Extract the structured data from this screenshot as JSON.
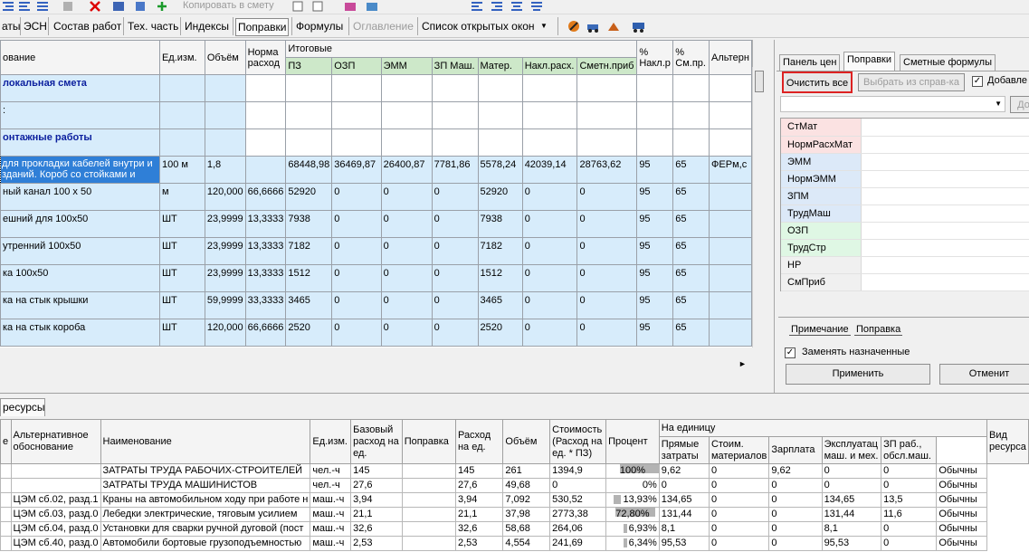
{
  "toolbar_top": {
    "copy_label": "Копировать в смету"
  },
  "tabs": [
    {
      "label": "аты",
      "state": "normal"
    },
    {
      "label": "ЭСН",
      "state": "normal"
    },
    {
      "label": "Состав работ",
      "state": "normal"
    },
    {
      "label": "Тех. часть",
      "state": "normal"
    },
    {
      "label": "Индексы",
      "state": "normal"
    },
    {
      "label": "Поправки",
      "state": "selected"
    },
    {
      "label": "Формулы",
      "state": "normal"
    },
    {
      "label": "Оглавление",
      "state": "disabled"
    },
    {
      "label": "Список открытых окон",
      "state": "normal"
    }
  ],
  "main_grid": {
    "headers": {
      "name": "ование",
      "unit": "Ед.изм.",
      "volume": "Объём",
      "norm": "Норма расход",
      "totals": "Итоговые",
      "pz": "ПЗ",
      "ozp": "ОЗП",
      "emm": "ЭММ",
      "zpm": "ЗП Маш.",
      "mater": "Матер.",
      "nakl": "Накл.расх.",
      "smetn": "Сметн.приб",
      "pnakl": "% Накл.р",
      "psm": "% См.пр.",
      "alt": "Альтерн"
    },
    "rows": [
      {
        "type": "header",
        "name": "локальная смета"
      },
      {
        "type": "blank",
        "name": ":"
      },
      {
        "type": "header",
        "name": "онтажные работы"
      },
      {
        "type": "selected",
        "name": "для прокладки кабелей внутри и зданий. Короб со стойками и",
        "unit": "100 м",
        "volume": "1,8",
        "norm": "",
        "pz": "68448,98",
        "ozp": "36469,87",
        "emm": "26400,87",
        "zpm": "7781,86",
        "mater": "5578,24",
        "nakl": "42039,14",
        "smetn": "28763,62",
        "pnakl": "95",
        "psm": "65",
        "alt": "ФЕРм,с"
      },
      {
        "type": "item",
        "name": "ный канал 100 х 50",
        "unit": "м",
        "volume": "120,000",
        "norm": "66,6666",
        "pz": "52920",
        "ozp": "0",
        "emm": "0",
        "zpm": "0",
        "mater": "52920",
        "nakl": "0",
        "smetn": "0",
        "pnakl": "95",
        "psm": "65",
        "alt": ""
      },
      {
        "type": "item",
        "name": "ешний для 100х50",
        "unit": "ШТ",
        "volume": "23,9999",
        "norm": "13,3333",
        "pz": "7938",
        "ozp": "0",
        "emm": "0",
        "zpm": "0",
        "mater": "7938",
        "nakl": "0",
        "smetn": "0",
        "pnakl": "95",
        "psm": "65",
        "alt": ""
      },
      {
        "type": "item",
        "name": "утренний 100х50",
        "unit": "ШТ",
        "volume": "23,9999",
        "norm": "13,3333",
        "pz": "7182",
        "ozp": "0",
        "emm": "0",
        "zpm": "0",
        "mater": "7182",
        "nakl": "0",
        "smetn": "0",
        "pnakl": "95",
        "psm": "65",
        "alt": ""
      },
      {
        "type": "item",
        "name": "ка 100х50",
        "unit": "ШТ",
        "volume": "23,9999",
        "norm": "13,3333",
        "pz": "1512",
        "ozp": "0",
        "emm": "0",
        "zpm": "0",
        "mater": "1512",
        "nakl": "0",
        "smetn": "0",
        "pnakl": "95",
        "psm": "65",
        "alt": ""
      },
      {
        "type": "item",
        "name": "ка на стык крышки",
        "unit": "ШТ",
        "volume": "59,9999",
        "norm": "33,3333",
        "pz": "3465",
        "ozp": "0",
        "emm": "0",
        "zpm": "0",
        "mater": "3465",
        "nakl": "0",
        "smetn": "0",
        "pnakl": "95",
        "psm": "65",
        "alt": ""
      },
      {
        "type": "item",
        "name": "ка на стык короба",
        "unit": "ШТ",
        "volume": "120,000",
        "norm": "66,6666",
        "pz": "2520",
        "ozp": "0",
        "emm": "0",
        "zpm": "0",
        "mater": "2520",
        "nakl": "0",
        "smetn": "0",
        "pnakl": "95",
        "psm": "65",
        "alt": ""
      }
    ]
  },
  "right_panel": {
    "tabs": [
      "Панель цен",
      "Поправки",
      "Сметные формулы"
    ],
    "clear_all": "Очистить все",
    "choose_ref": "Выбрать из справ-ка",
    "add_check": "Добавле",
    "combo_btn": "До",
    "corrections": [
      {
        "label": "СтМат",
        "color": "#fbe2e2"
      },
      {
        "label": "НормРасхМат",
        "color": "#fbe2e2"
      },
      {
        "label": "ЭММ",
        "color": "#dce9f8"
      },
      {
        "label": "НормЭММ",
        "color": "#dce9f8"
      },
      {
        "label": "ЗПМ",
        "color": "#dce9f8"
      },
      {
        "label": "ТрудМаш",
        "color": "#dce9f8"
      },
      {
        "label": "ОЗП",
        "color": "#dff7e4"
      },
      {
        "label": "ТрудСтр",
        "color": "#dff7e4"
      },
      {
        "label": "НР",
        "color": "#f0f0f0"
      },
      {
        "label": "СмПриб",
        "color": "#f0f0f0"
      }
    ],
    "sub_tabs": [
      "Примечание",
      "Поправка"
    ],
    "replace_label": "Заменять назначенные",
    "apply": "Применить",
    "cancel": "Отменит"
  },
  "bottom": {
    "tab": "ресурсы",
    "headers": {
      "c0": "е",
      "alt": "Альтернативное обоснование",
      "name": "Наименование",
      "unit": "Ед.изм.",
      "base": "Базовый расход на ед.",
      "corr": "Поправка",
      "rate": "Расход на ед.",
      "vol": "Объём",
      "cost": "Стоимость (Расход на ед. * ПЗ)",
      "pct": "Процент",
      "per_unit": "На единицу",
      "direct": "Прямые затраты",
      "mat": "Стоим. материалов",
      "sal": "Зарплата",
      "mach": "Эксплуатац маш. и мех.",
      "zpmach": "ЗП раб., обсл.маш.",
      "type": "Вид ресурса"
    },
    "rows": [
      {
        "alt": "",
        "name": "ЗАТРАТЫ ТРУДА РАБОЧИХ-СТРОИТЕЛЕЙ",
        "unit": "чел.-ч",
        "base": "145",
        "corr": "",
        "rate": "145",
        "vol": "261",
        "cost": "1394,9",
        "pct": "100%",
        "pct_value": 100,
        "direct": "9,62",
        "mat": "0",
        "sal": "9,62",
        "mach": "0",
        "zpm": "0",
        "type": "Обычны"
      },
      {
        "alt": "",
        "name": "ЗАТРАТЫ ТРУДА МАШИНИСТОВ",
        "unit": "чел.-ч",
        "base": "27,6",
        "corr": "",
        "rate": "27,6",
        "vol": "49,68",
        "cost": "0",
        "pct": "0%",
        "pct_value": 0,
        "direct": "0",
        "mat": "0",
        "sal": "0",
        "mach": "0",
        "zpm": "0",
        "type": "Обычны"
      },
      {
        "alt": "ЦЭМ сб.02, разд.1",
        "name": "Краны на автомобильном ходу при работе н",
        "unit": "маш.-ч",
        "base": "3,94",
        "corr": "",
        "rate": "3,94",
        "vol": "7,092",
        "cost": "530,52",
        "pct": "13,93%",
        "pct_value": 13.93,
        "direct": "134,65",
        "mat": "0",
        "sal": "0",
        "mach": "134,65",
        "zpm": "13,5",
        "type": "Обычны"
      },
      {
        "alt": "ЦЭМ сб.03, разд.0",
        "name": "Лебедки электрические, тяговым усилием",
        "unit": "маш.-ч",
        "base": "21,1",
        "corr": "",
        "rate": "21,1",
        "vol": "37,98",
        "cost": "2773,38",
        "pct": "72,80%",
        "pct_value": 72.8,
        "direct": "131,44",
        "mat": "0",
        "sal": "0",
        "mach": "131,44",
        "zpm": "11,6",
        "type": "Обычны"
      },
      {
        "alt": "ЦЭМ сб.04, разд.0",
        "name": "Установки для сварки ручной дуговой (пост",
        "unit": "маш.-ч",
        "base": "32,6",
        "corr": "",
        "rate": "32,6",
        "vol": "58,68",
        "cost": "264,06",
        "pct": "6,93%",
        "pct_value": 6.93,
        "direct": "8,1",
        "mat": "0",
        "sal": "0",
        "mach": "8,1",
        "zpm": "0",
        "type": "Обычны"
      },
      {
        "alt": "ЦЭМ сб.40, разд.0",
        "name": "Автомобили бортовые грузоподъемностью",
        "unit": "маш.-ч",
        "base": "2,53",
        "corr": "",
        "rate": "2,53",
        "vol": "4,554",
        "cost": "241,69",
        "pct": "6,34%",
        "pct_value": 6.34,
        "direct": "95,53",
        "mat": "0",
        "sal": "0",
        "mach": "95,53",
        "zpm": "0",
        "type": "Обычны"
      }
    ]
  }
}
